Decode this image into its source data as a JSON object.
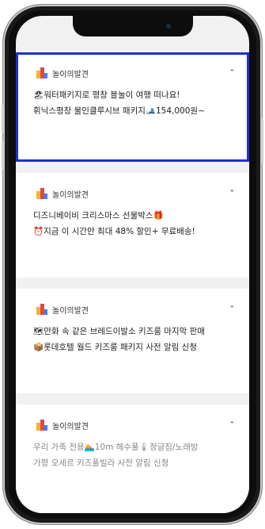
{
  "notifications": [
    {
      "app_name": "놀이의발견",
      "line1": "🏖워터패키지로 평창 블눌이 여행 떠나요!",
      "line2": "휘닉스평창 물인클루시브 패키지🎿154,000원~"
    },
    {
      "app_name": "놀이의발견",
      "line1": "디즈니베이비 크리스마스 선물박스🎁",
      "line2": "⏰지금 이 시간만 최대 48% 할인+ 무료배송!"
    },
    {
      "app_name": "놀이의발견",
      "line1": "🗺만화 속 같은 브레드이발소 키즈룸 마지막 판매",
      "line2": "📦롯데호텔 월드 키즈룸 패키지 사전 알림 신청"
    },
    {
      "app_name": "놀이의발견",
      "line1": "우리 가족 전용🏊10m 헤수풀🌡정글짐/노래방",
      "line2": "가평 오세르 키즈풀빌라 사전 알림 신청"
    }
  ],
  "chevron_symbol": "⌃",
  "highlight_color": "#1f2fd6"
}
